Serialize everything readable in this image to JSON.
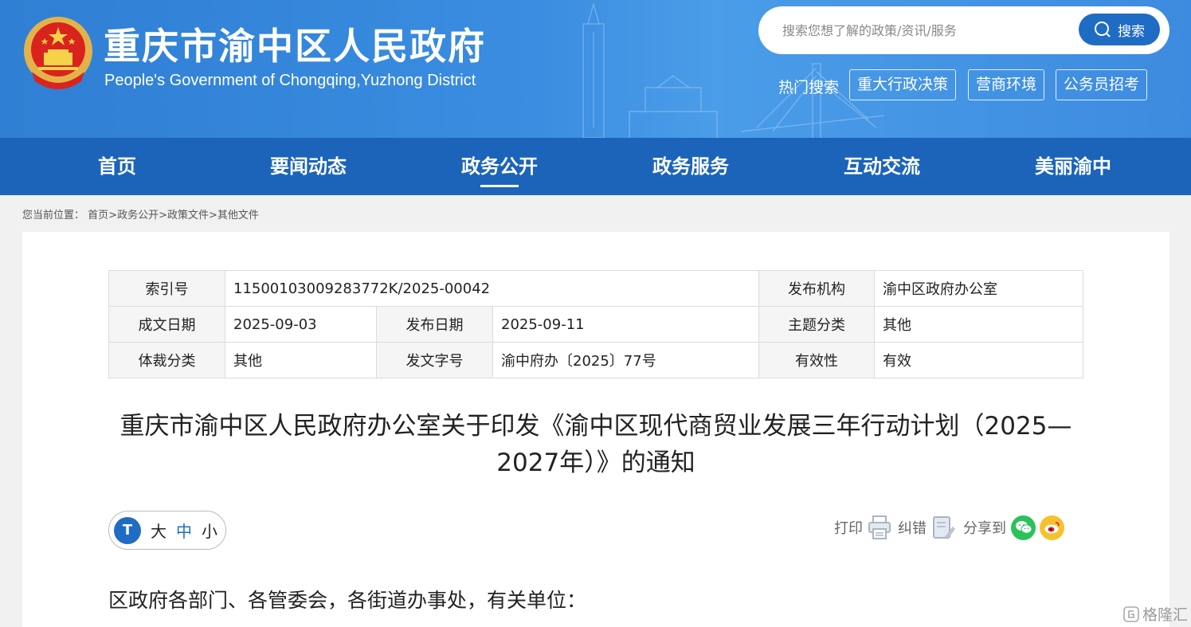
{
  "header": {
    "title": "重庆市渝中区人民政府",
    "subtitle": "People's Government of Chongqing,Yuzhong District",
    "search_placeholder": "搜索您想了解的政策/资讯/服务",
    "search_button": "搜索",
    "hot_label": "热门搜索",
    "hot_tags": [
      "重大行政决策",
      "营商环境",
      "公务员招考"
    ]
  },
  "nav": {
    "items": [
      "首页",
      "要闻动态",
      "政务公开",
      "政务服务",
      "互动交流",
      "美丽渝中"
    ],
    "active": "政务公开"
  },
  "breadcrumb": {
    "prefix": "您当前位置：",
    "items": [
      "首页",
      "政务公开",
      "政策文件",
      "其他文件"
    ],
    "separator": ">"
  },
  "info": {
    "index_label": "索引号",
    "index_value": "11500103009283772K/2025-00042",
    "org_label": "发布机构",
    "org_value": "渝中区政府办公室",
    "written_label": "成文日期",
    "written_value": "2025-09-03",
    "publish_label": "发布日期",
    "publish_value": "2025-09-11",
    "topic_label": "主题分类",
    "topic_value": "其他",
    "genre_label": "体裁分类",
    "genre_value": "其他",
    "docno_label": "发文字号",
    "docno_value": "渝中府办〔2025〕77号",
    "valid_label": "有效性",
    "valid_value": "有效"
  },
  "document": {
    "title": "重庆市渝中区人民政府办公室关于印发《渝中区现代商贸业发展三年行动计划（2025—2027年）》的通知",
    "greeting": "区政府各部门、各管委会，各街道办事处，有关单位："
  },
  "font_size": {
    "large": "大",
    "medium": "中",
    "small": "小"
  },
  "tools": {
    "print": "打印",
    "correction": "纠错",
    "share": "分享到"
  },
  "watermark": "格隆汇",
  "colors": {
    "header_blue": "#3a8de0",
    "nav_blue": "#1b64b9",
    "accent": "#1f6cc4",
    "wechat": "#2bc25a",
    "weibo": "#f5c22e"
  }
}
